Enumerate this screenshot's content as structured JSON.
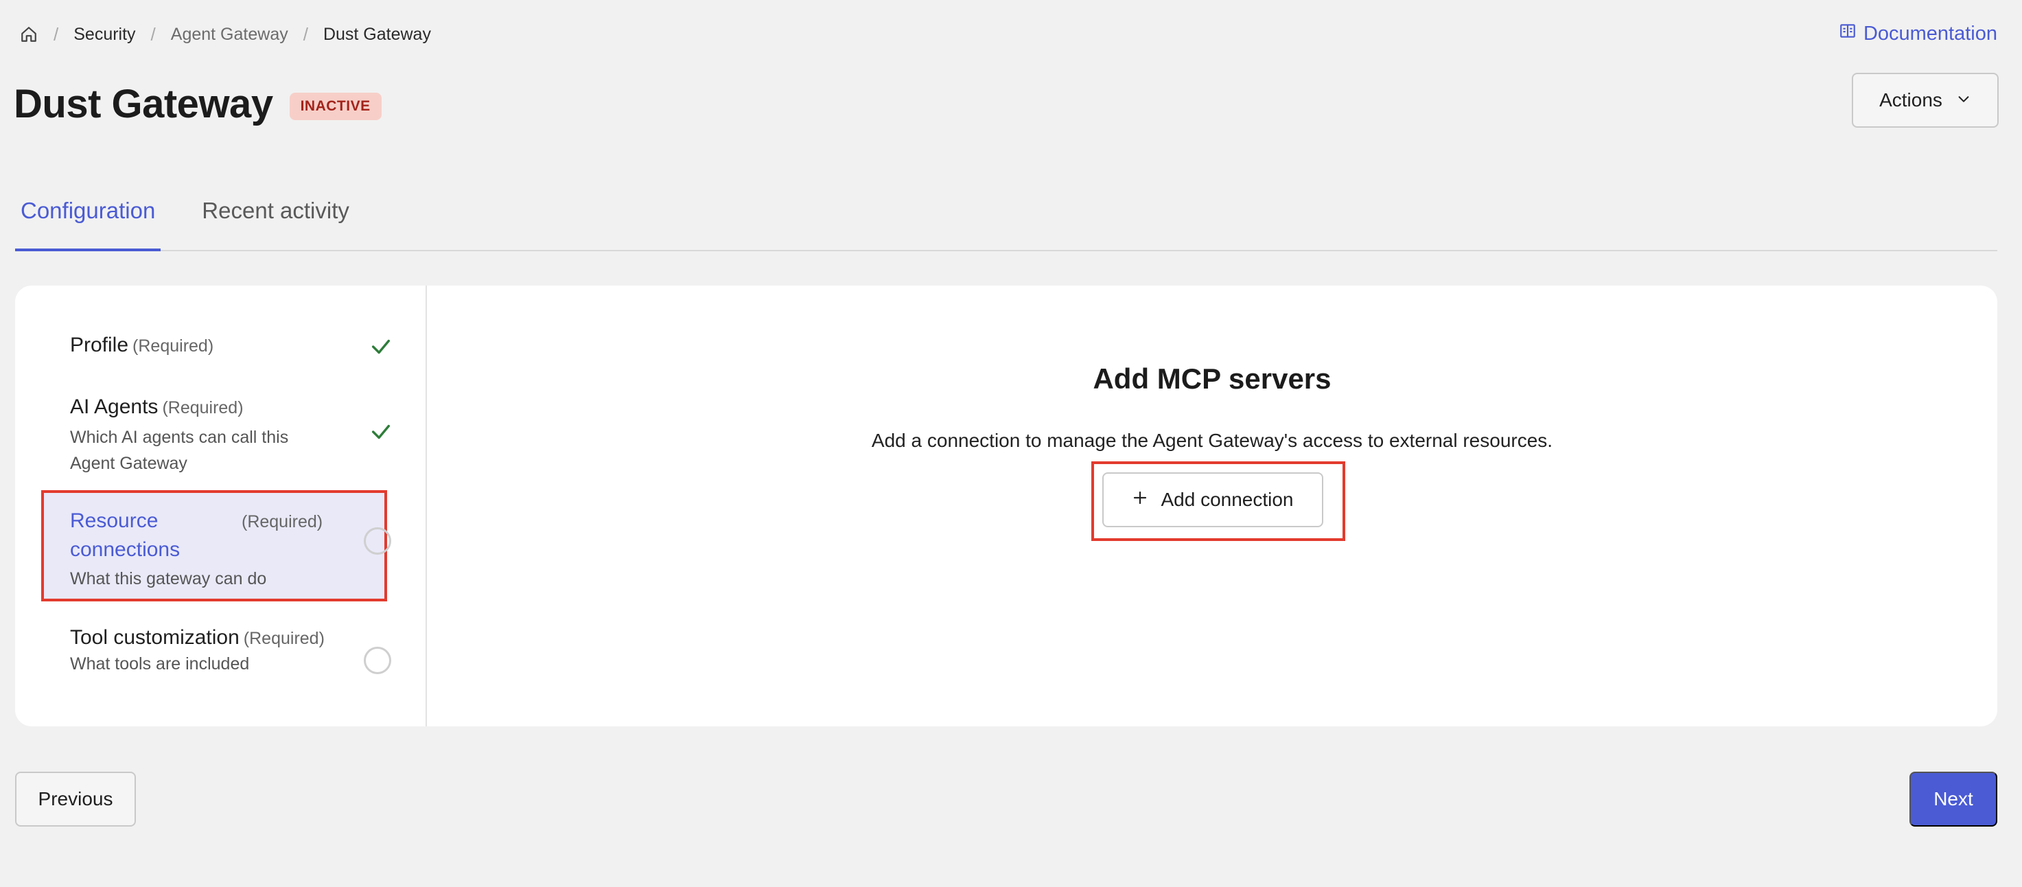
{
  "breadcrumb": {
    "home_icon": "home-icon",
    "items": [
      "Security",
      "Agent Gateway",
      "Dust Gateway"
    ]
  },
  "header": {
    "documentation_label": "Documentation",
    "documentation_icon": "book-icon",
    "title": "Dust Gateway",
    "status_badge": "INACTIVE",
    "actions_label": "Actions"
  },
  "tabs": [
    {
      "label": "Configuration",
      "active": true
    },
    {
      "label": "Recent activity",
      "active": false
    }
  ],
  "steps": [
    {
      "name": "Profile",
      "required": "(Required)",
      "description": "",
      "status": "complete"
    },
    {
      "name": "AI Agents",
      "required": "(Required)",
      "description": "Which AI agents can call this Agent Gateway",
      "status": "complete"
    },
    {
      "name": "Resource connections",
      "required": "(Required)",
      "description": "What this gateway can do",
      "status": "current"
    },
    {
      "name": "Tool customization",
      "required": "(Required)",
      "description": "What tools are included",
      "status": "incomplete"
    }
  ],
  "main": {
    "title": "Add MCP servers",
    "description": "Add a connection to manage the Agent Gateway's access to external resources.",
    "add_button_label": "Add connection"
  },
  "footer": {
    "previous_label": "Previous",
    "next_label": "Next"
  },
  "colors": {
    "accent": "#4a5bd4",
    "highlight": "#e23b2e",
    "badge_bg": "#f7cfc8",
    "check": "#2e7d3a"
  }
}
